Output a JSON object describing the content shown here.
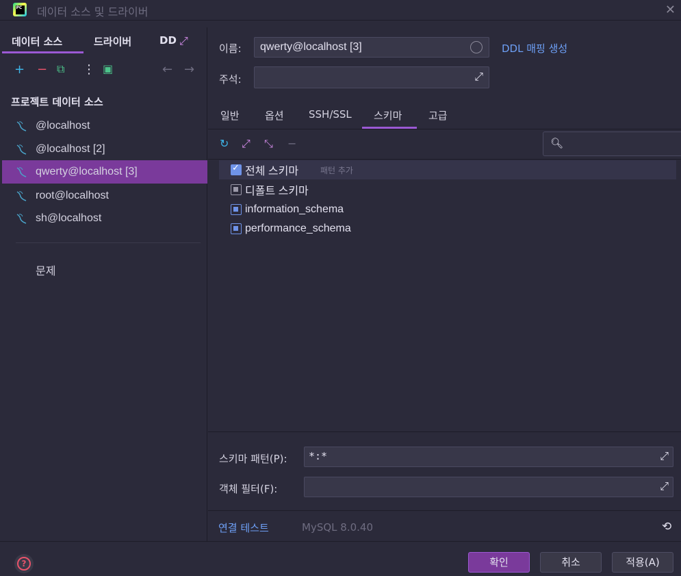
{
  "window": {
    "title": "데이터 소스 및 드라이버",
    "close_icon": "close-icon"
  },
  "left": {
    "tabs": [
      "데이터 소스",
      "드라이버",
      "DD"
    ],
    "section_title": "프로젝트 데이터 소스",
    "items": [
      {
        "label": "@localhost"
      },
      {
        "label": "@localhost [2]"
      },
      {
        "label": "qwerty@localhost [3]"
      },
      {
        "label": "root@localhost"
      },
      {
        "label": "sh@localhost"
      }
    ],
    "problems": "문제"
  },
  "form": {
    "name_label": "이름:",
    "name_value": "qwerty@localhost [3]",
    "ddl_link": "DDL 매핑 생성",
    "comment_label": "주석:"
  },
  "tabs": [
    "일반",
    "옵션",
    "SSH/SSL",
    "스키마",
    "고급"
  ],
  "schemas": [
    {
      "label": "전체 스키마",
      "hint": "패턴 추가"
    },
    {
      "label": "디폴트 스키마"
    },
    {
      "label": "information_schema"
    },
    {
      "label": "performance_schema"
    }
  ],
  "pattern": {
    "schema_label": "스키마 패턴(P):",
    "schema_value": "*:*",
    "object_label": "객체 필터(F):"
  },
  "connection": {
    "test_link": "연결 테스트",
    "driver_version": "MySQL 8.0.40"
  },
  "buttons": {
    "ok": "확인",
    "cancel": "취소",
    "apply": "적용(A)"
  },
  "colors": {
    "accent": "#9b59d4",
    "selection": "#7a3a9b",
    "link": "#6d9ff5",
    "background": "#2b2a3a"
  }
}
